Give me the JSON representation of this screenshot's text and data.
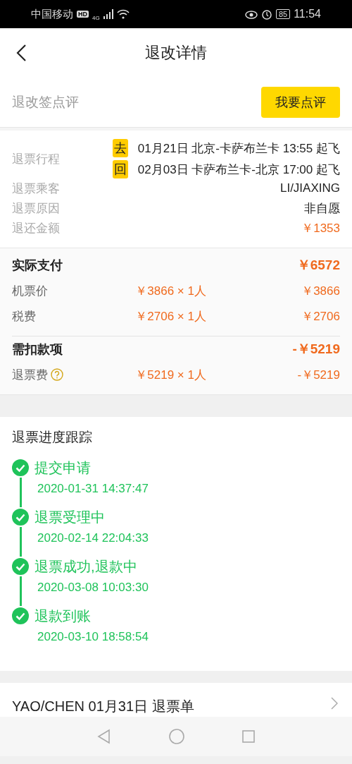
{
  "status_bar": {
    "carrier": "中国移动",
    "hd": "HD",
    "network": "4G",
    "battery": "85",
    "time": "11:54"
  },
  "header": {
    "title": "退改详情"
  },
  "review": {
    "label": "退改签点评",
    "button": "我要点评"
  },
  "info": {
    "itinerary_label": "退票行程",
    "legs": [
      {
        "tag": "去",
        "text": "01月21日 北京-卡萨布兰卡 13:55 起飞"
      },
      {
        "tag": "回",
        "text": "02月03日 卡萨布兰卡-北京 17:00 起飞"
      }
    ],
    "rows": [
      {
        "label": "退票乘客",
        "value": "LI/JIAXING",
        "kind": "plain"
      },
      {
        "label": "退票原因",
        "value": "非自愿",
        "kind": "plain"
      },
      {
        "label": "退还金额",
        "value": "￥1353",
        "kind": "money"
      }
    ]
  },
  "prices": [
    {
      "kind": "total",
      "label": "实际支付",
      "amount": "￥6572"
    },
    {
      "kind": "item",
      "label": "机票价",
      "unit": "￥3866 × 1人",
      "amount": "￥3866"
    },
    {
      "kind": "item",
      "label": "税费",
      "unit": "￥2706 × 1人",
      "amount": "￥2706"
    },
    {
      "kind": "total",
      "label": "需扣款项",
      "amount": "-￥5219",
      "divider": true
    },
    {
      "kind": "item",
      "label": "退票费",
      "unit": "￥5219 × 1人",
      "amount": "-￥5219",
      "help": true
    }
  ],
  "progress": {
    "title": "退票进度跟踪",
    "steps": [
      {
        "title": "提交申请",
        "time": "2020-01-31 14:37:47",
        "done": true
      },
      {
        "title": "退票受理中",
        "time": "2020-02-14 22:04:33",
        "done": true
      },
      {
        "title": "退票成功,退款中",
        "time": "2020-03-08 10:03:30",
        "done": true
      },
      {
        "title": "退款到账",
        "time": "2020-03-10 18:58:54",
        "done": true
      }
    ]
  },
  "order": {
    "text": "YAO/CHEN 01月31日 退票单"
  }
}
